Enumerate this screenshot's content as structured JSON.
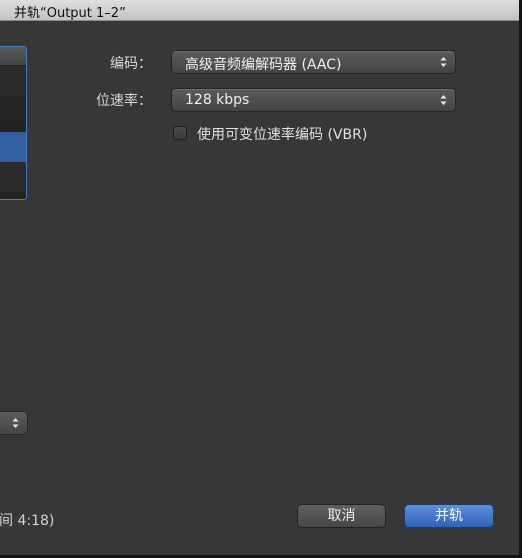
{
  "window": {
    "title": "并轨“Output 1–2”"
  },
  "settings": {
    "codec_label": "编码：",
    "codec_value": "高级音频编解码器 (AAC)",
    "bitrate_label": "位速率：",
    "bitrate_value": "128 kbps",
    "vbr_label": "使用可变位速率编码 (VBR)",
    "vbr_checked": false
  },
  "footer": {
    "duration_text": "间 4:18)",
    "cancel_label": "取消",
    "merge_label": "并轨"
  },
  "colors": {
    "dialog_bg": "#373737",
    "primary_button": "#3a6fc4",
    "selection": "#315f9f"
  }
}
